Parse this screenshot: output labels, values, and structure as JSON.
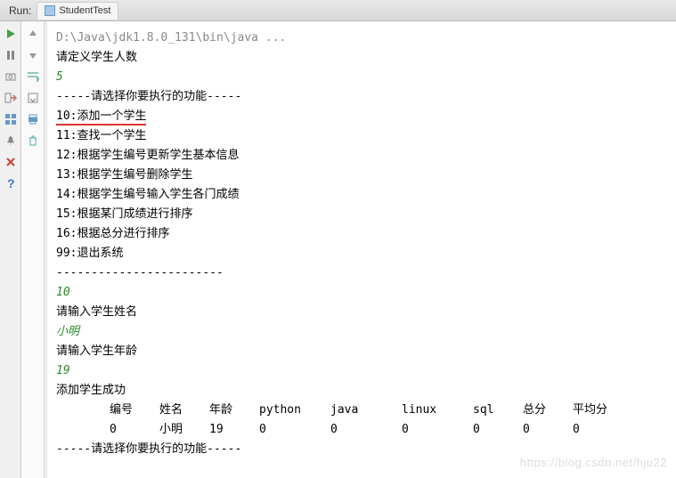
{
  "tab": {
    "run_label": "Run:",
    "title": "StudentTest"
  },
  "console": {
    "command": "D:\\Java\\jdk1.8.0_131\\bin\\java ...",
    "prompt_define_count": "请定义学生人数",
    "input_count": "5",
    "menu_header": "-----请选择你要执行的功能-----",
    "menu": {
      "m10": "10:添加一个学生",
      "m11": "11:查找一个学生",
      "m12": "12:根据学生编号更新学生基本信息",
      "m13": "13:根据学生编号删除学生",
      "m14": "14:根据学生编号输入学生各门成绩",
      "m15": "15:根据某门成绩进行排序",
      "m16": "16:根据总分进行排序",
      "m99": "99:退出系统"
    },
    "divider": "------------------------",
    "input_choice": "10",
    "prompt_name": "请输入学生姓名",
    "input_name": "小明",
    "prompt_age": "请输入学生年龄",
    "input_age": "19",
    "success_msg": "添加学生成功",
    "table": {
      "headers": [
        "编号",
        "姓名",
        "年龄",
        "python",
        "java",
        "linux",
        "sql",
        "总分",
        "平均分"
      ],
      "row": [
        "0",
        "小明",
        "19",
        "0",
        "0",
        "0",
        "0",
        "0",
        "0"
      ]
    },
    "menu_header_2": "-----请选择你要执行的功能-----"
  },
  "watermark": "https://blog.csdn.net/hju22"
}
